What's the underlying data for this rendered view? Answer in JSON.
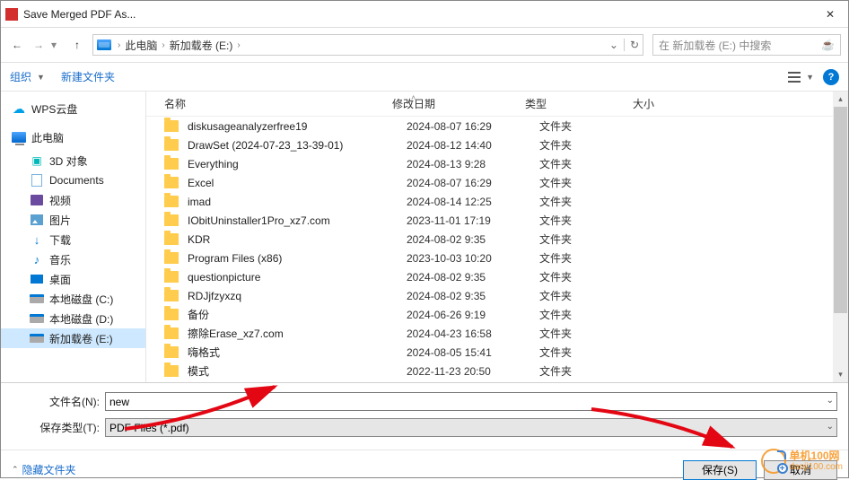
{
  "window": {
    "title": "Save Merged PDF As..."
  },
  "address": {
    "crumbs": [
      "此电脑",
      "新加载卷 (E:)"
    ]
  },
  "search": {
    "placeholder": "在 新加载卷 (E:) 中搜索"
  },
  "toolbar": {
    "organize": "组织",
    "new_folder": "新建文件夹"
  },
  "sidebar": {
    "top": [
      {
        "label": "WPS云盘",
        "icon": "cloud"
      },
      {
        "label": "此电脑",
        "icon": "pc"
      }
    ],
    "children": [
      {
        "label": "3D 对象",
        "icon": "3d"
      },
      {
        "label": "Documents",
        "icon": "doc"
      },
      {
        "label": "视频",
        "icon": "video"
      },
      {
        "label": "图片",
        "icon": "pic"
      },
      {
        "label": "下载",
        "icon": "down"
      },
      {
        "label": "音乐",
        "icon": "music"
      },
      {
        "label": "桌面",
        "icon": "desktop"
      },
      {
        "label": "本地磁盘 (C:)",
        "icon": "disk"
      },
      {
        "label": "本地磁盘 (D:)",
        "icon": "disk"
      },
      {
        "label": "新加载卷 (E:)",
        "icon": "disk",
        "selected": true
      }
    ]
  },
  "columns": {
    "name": "名称",
    "date": "修改日期",
    "type": "类型",
    "size": "大小"
  },
  "files": [
    {
      "name": "diskusageanalyzerfree19",
      "date": "2024-08-07 16:29",
      "type": "文件夹"
    },
    {
      "name": "DrawSet (2024-07-23_13-39-01)",
      "date": "2024-08-12 14:40",
      "type": "文件夹"
    },
    {
      "name": "Everything",
      "date": "2024-08-13 9:28",
      "type": "文件夹"
    },
    {
      "name": "Excel",
      "date": "2024-08-07 16:29",
      "type": "文件夹"
    },
    {
      "name": "imad",
      "date": "2024-08-14 12:25",
      "type": "文件夹"
    },
    {
      "name": "IObitUninstaller1Pro_xz7.com",
      "date": "2023-11-01 17:19",
      "type": "文件夹"
    },
    {
      "name": "KDR",
      "date": "2024-08-02 9:35",
      "type": "文件夹"
    },
    {
      "name": "Program Files (x86)",
      "date": "2023-10-03 10:20",
      "type": "文件夹"
    },
    {
      "name": "questionpicture",
      "date": "2024-08-02 9:35",
      "type": "文件夹"
    },
    {
      "name": "RDJjfzyxzq",
      "date": "2024-08-02 9:35",
      "type": "文件夹"
    },
    {
      "name": "备份",
      "date": "2024-06-26 9:19",
      "type": "文件夹"
    },
    {
      "name": "擦除Erase_xz7.com",
      "date": "2024-04-23 16:58",
      "type": "文件夹"
    },
    {
      "name": "嗨格式",
      "date": "2024-08-05 15:41",
      "type": "文件夹"
    },
    {
      "name": "模式",
      "date": "2022-11-23 20:50",
      "type": "文件夹"
    }
  ],
  "fields": {
    "filename_label": "文件名(N):",
    "filename_value": "new",
    "filetype_label": "保存类型(T):",
    "filetype_value": "PDF Files  (*.pdf)"
  },
  "footer": {
    "hide_folders": "隐藏文件夹",
    "save": "保存(S)",
    "cancel": "取消"
  },
  "watermark": {
    "cn": "单机100网",
    "en": "danji100.com"
  }
}
